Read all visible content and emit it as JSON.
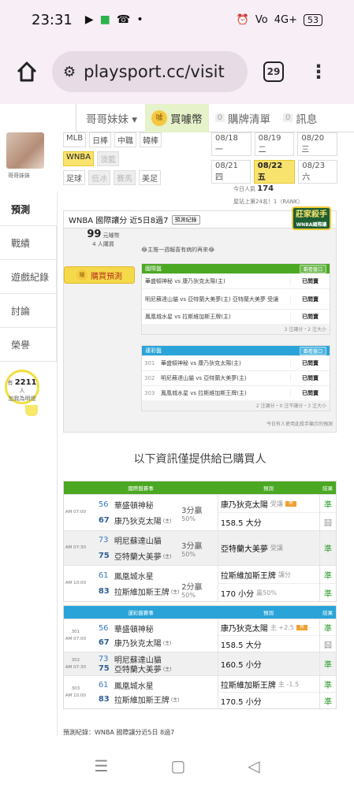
{
  "status_bar": {
    "time": "23:31",
    "battery": "53",
    "signal_text": "4G+"
  },
  "browser": {
    "url": "playsport.cc/visit",
    "tab_count": "29"
  },
  "topnav": {
    "user": "哥哥妹妹 ▾",
    "buy_coin": "買噱幣",
    "cart_count": "0",
    "cart": "購牌清單",
    "msg_count": "0",
    "messages": "訊息"
  },
  "profile": {
    "name": "哥哥妹妹"
  },
  "sidebar": {
    "items": [
      "預測",
      "戰績",
      "遊戲紀錄",
      "討論",
      "榮譽"
    ]
  },
  "popularity": {
    "prefix": "有",
    "count": "2211",
    "unit": "人",
    "sub": "加我為明燈"
  },
  "filters": {
    "row1": [
      "MLB",
      "日棒",
      "中職",
      "韓棒"
    ],
    "row2": [
      "WNBA",
      "澳籃"
    ],
    "row3": [
      "足球",
      "低冰",
      "賽馬",
      "美足"
    ]
  },
  "dates": {
    "row1": [
      "08/18 一",
      "08/19 二",
      "08/20 三"
    ],
    "row2": [
      "08/21 四",
      "08/22 五",
      "08/23 六"
    ]
  },
  "stats": {
    "today_label": "今日人氣",
    "today": "174",
    "rank": "屋站上第24名！1（RANK）"
  },
  "card": {
    "title": "WNBA 國際讓分 近5日8過7",
    "record_tag": "預測紀錄",
    "killer_badge": "莊家殺手",
    "killer_sub": "WNBA國際讓",
    "price": "99",
    "price_unit": "元噱幣",
    "buyers": "4 人購買",
    "buy_button": "購買預測",
    "note": "😂主推一週報喜有病的再來😂",
    "spread_header": "國際盤",
    "spread_btn": "觀看盤口",
    "spread_rows": [
      {
        "game": "華盛頓神秘 vs 康乃狄克太陽(主)",
        "status": "已問賣"
      },
      {
        "game": "明尼蘇達山貓 vs 亞特蘭大美夢(主) 亞特蘭大美夢 受讓",
        "status": "已問賣"
      },
      {
        "game": "鳳凰城水星 vs 拉斯維加斯王牌(主)",
        "status": "已問賣"
      }
    ],
    "spread_count": "3 注讓分・2 注大小",
    "taiwan_header": "運彩盤",
    "taiwan_btn": "觀看盤口",
    "taiwan_rows": [
      {
        "no": "301",
        "game": "華盛頓神秘 vs 康乃狄克太陽(主)",
        "status": "已問賣"
      },
      {
        "no": "302",
        "game": "明尼蘇達山貓 vs 亞特蘭大美夢(主)",
        "status": "已問賣"
      },
      {
        "no": "303",
        "game": "鳳凰城水星 vs 拉斯維加斯王牌(主)",
        "status": "已問賣"
      }
    ],
    "taiwan_count": "2 注讓分・0 注不讓分・3 注大小",
    "daily_note": "今日有人使用此殺手顯示的預測"
  },
  "info_line": "以下資訊僅提供給已購買人",
  "table1": {
    "headers": [
      "國際盤賽事",
      "預測",
      "結果"
    ],
    "color": "#4aa823",
    "rows": [
      {
        "time": "AM 07:00",
        "n1": "56",
        "t1": "華盛頓神秘",
        "n2": "67",
        "t2": "康乃狄克太陽",
        "h": "(主)",
        "odds": "3分贏",
        "pct": "50%",
        "p1": "康乃狄克太陽",
        "p1s": "受讓",
        "p2": "158.5 大分",
        "p2s": "",
        "r1": "準",
        "r2": "囧"
      },
      {
        "time": "AM 07:30",
        "n1": "73",
        "t1": "明尼蘇達山貓",
        "n2": "75",
        "t2": "亞特蘭大美夢",
        "h": "(主)",
        "odds": "3分贏",
        "pct": "50%",
        "p1": "亞特蘭大美夢",
        "p1s": "受讓",
        "p2": "",
        "p2s": "",
        "r1": "準",
        "r2": ""
      },
      {
        "time": "AM 10:00",
        "n1": "61",
        "t1": "鳳凰城水星",
        "n2": "83",
        "t2": "拉斯維加斯王牌",
        "h": "(主)",
        "odds": "2分贏",
        "pct": "50%",
        "p1": "拉斯維加斯王牌",
        "p1s": "讓分",
        "p2": "170 小分",
        "p2s": "贏50%",
        "r1": "準",
        "r2": "準"
      }
    ]
  },
  "table2": {
    "headers": [
      "運彩盤賽事",
      "預測",
      "結果"
    ],
    "color": "#2aa4d8",
    "rows": [
      {
        "no": "301",
        "time": "AM 07:00",
        "n1": "56",
        "t1": "華盛頓神秘",
        "n2": "67",
        "t2": "康乃狄克太陽",
        "h": "(主)",
        "p1": "康乃狄克太陽",
        "p1s": "主 +2.5",
        "p2": "158.5 大分",
        "r1": "準",
        "r2": "囧"
      },
      {
        "no": "302",
        "time": "AM 07:30",
        "n1": "73",
        "t1": "明尼蘇達山貓",
        "n2": "75",
        "t2": "亞特蘭大美夢",
        "h": "(主)",
        "p1": "160.5 小分",
        "p1s": "",
        "p2": "",
        "r1": "準",
        "r2": ""
      },
      {
        "no": "303",
        "time": "AM 10:00",
        "n1": "61",
        "t1": "鳳凰城水星",
        "n2": "83",
        "t2": "拉斯維加斯王牌",
        "h": "(主)",
        "p1": "拉斯維加斯王牌",
        "p1s": "主 -1.5",
        "p2": "170.5 小分",
        "r1": "準",
        "r2": "準"
      }
    ]
  },
  "footer_note": "預測紀錄：WNBA 國際讓分近5日 8過7"
}
